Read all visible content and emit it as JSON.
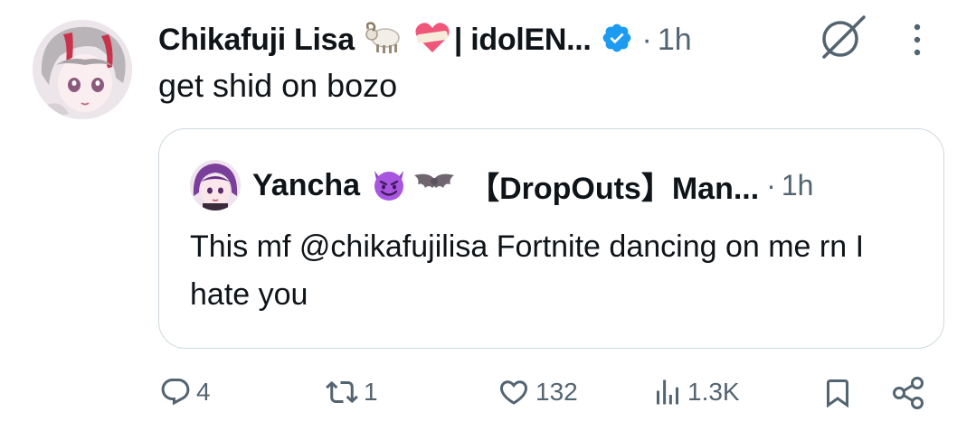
{
  "tweet": {
    "author_name": "Chikafuji Lisa",
    "author_suffix": "| idolEN...",
    "emojis": [
      "ram",
      "mending-heart"
    ],
    "verified": true,
    "separator": "·",
    "time": "1h",
    "text": "get shid on bozo"
  },
  "quote": {
    "author_name": "Yancha",
    "emojis": [
      "smiling-devil",
      "bat"
    ],
    "author_suffix": "【DropOuts】Man...",
    "separator": "·",
    "time": "1h",
    "text": "This mf @chikafujilisa Fortnite dancing on me rn I hate you"
  },
  "actions": {
    "replies": "4",
    "reposts": "1",
    "likes": "132",
    "views": "1.3K"
  },
  "colors": {
    "text": "#0f1419",
    "muted": "#536471",
    "border": "#cfd9de",
    "verified_blue": "#1d9bf0"
  }
}
